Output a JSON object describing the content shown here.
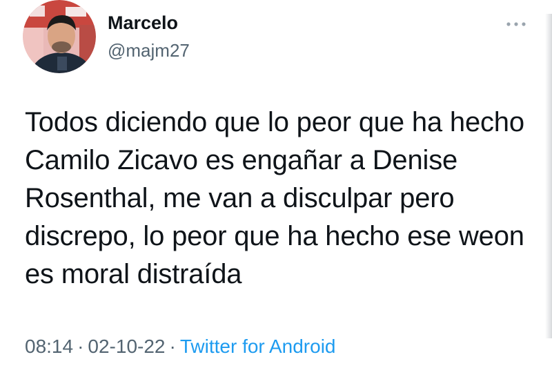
{
  "tweet": {
    "author": {
      "name": "Marcelo",
      "handle": "@majm27"
    },
    "text": "Todos diciendo que lo peor que ha hecho Camilo Zicavo es engañar a Denise Rosenthal, me van a disculpar pero discrepo, lo peor que ha hecho ese weon es moral distraída",
    "time": "08:14",
    "separator": "·",
    "date": "02-10-22",
    "source": "Twitter for Android"
  },
  "icons": {
    "more": "more-dots-icon",
    "avatar": "avatar-photo"
  },
  "colors": {
    "text_primary": "#0f1419",
    "text_secondary": "#536471",
    "link": "#1d9bf0"
  }
}
